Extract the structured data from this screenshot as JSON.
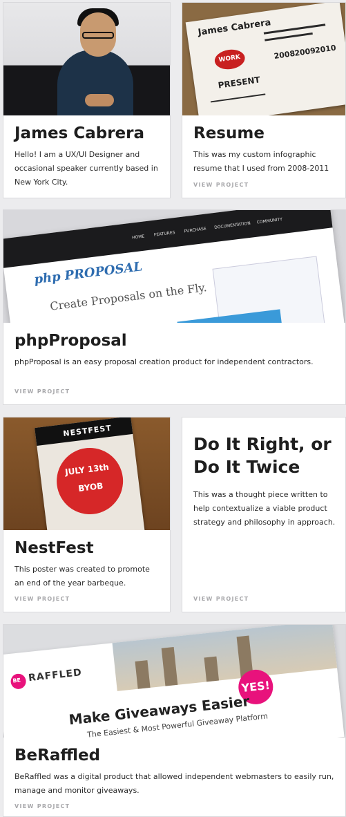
{
  "cards": {
    "james": {
      "title": "James Cabrera",
      "description": "Hello! I am a UX/UI Designer and occasional speaker currently based in New York City."
    },
    "resume": {
      "title": "Resume",
      "description": "This was my custom infographic resume that I used from 2008-2011",
      "link": "VIEW PROJECT",
      "thumb": {
        "name": "James Cabrera",
        "work": "WORK",
        "present": "PRESENT",
        "years": [
          "2008",
          "2009",
          "2010"
        ]
      }
    },
    "phpproposal": {
      "title": "phpProposal",
      "description": "phpProposal is an easy proposal creation product for independent contractors.",
      "link": "VIEW PROJECT",
      "thumb": {
        "logo": "php PROPOSAL",
        "headline": "Create Proposals on the Fly.",
        "nav": [
          "HOME",
          "FEATURES",
          "PURCHASE",
          "DOCUMENTATION",
          "COMMUNITY"
        ]
      }
    },
    "nestfest": {
      "title": "NestFest",
      "description": "This poster was created to promote an end of the year barbeque.",
      "link": "VIEW PROJECT",
      "thumb": {
        "name": "NESTFEST",
        "date": "JULY 13th",
        "byob": "BYOB"
      }
    },
    "doitright": {
      "title": "Do It Right, or Do It Twice",
      "description": "This was a thought piece written to help contextualize a viable product strategy and philosophy in approach.",
      "link": "VIEW PROJECT"
    },
    "beraffled": {
      "title": "BeRaffled",
      "description": "BeRaffled was a digital product that allowed independent webmasters to easily run, manage and monitor giveaways.",
      "link": "VIEW PROJECT",
      "thumb": {
        "badge": "BE",
        "brand": "RAFFLED",
        "yes": "YES!",
        "headline": "Make Giveaways Easier",
        "sub": "The Easiest & Most Powerful Giveaway Platform"
      }
    }
  },
  "colors": {
    "background": "#ececee",
    "card": "#ffffff",
    "link": "#a8a8ab",
    "accent_pink": "#e8127c"
  }
}
